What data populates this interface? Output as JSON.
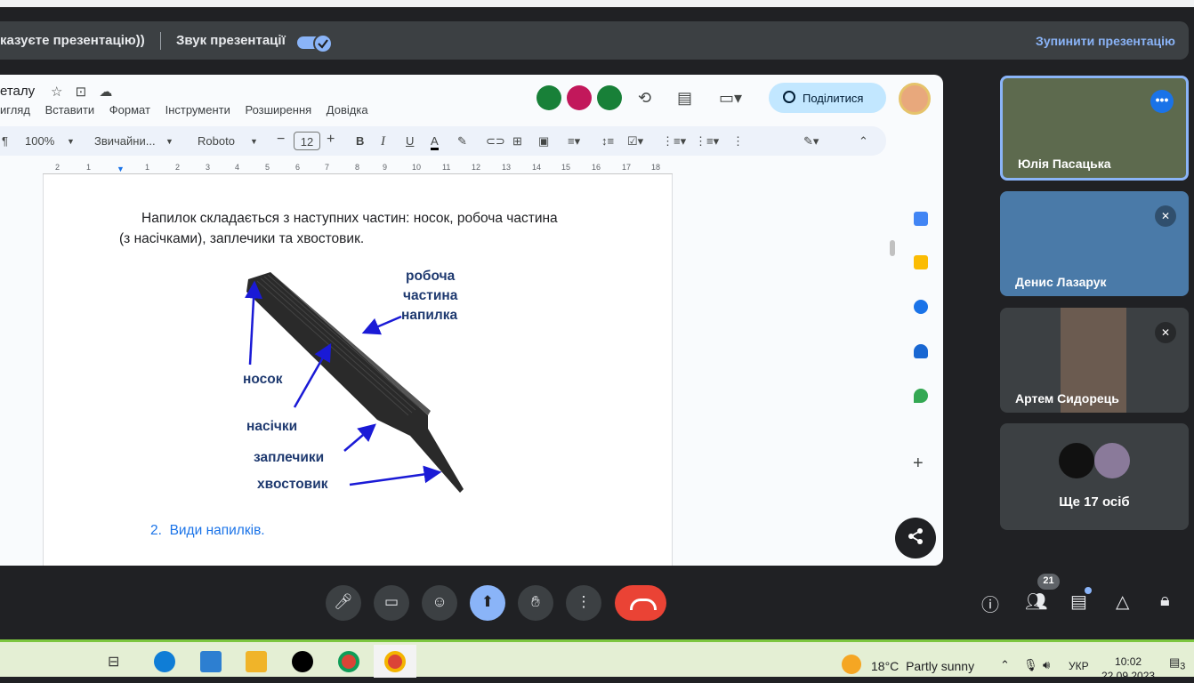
{
  "presentation_bar": {
    "message": "казуєте презентацію))",
    "sound_label": "Звук презентації",
    "sound_enabled": true,
    "stop_label": "Зупинити презентацію"
  },
  "doc": {
    "title": "еталу",
    "menu": [
      "игляд",
      "Вставити",
      "Формат",
      "Інструменти",
      "Розширення",
      "Довідка"
    ],
    "share_label": "Поділитися",
    "toolbar": {
      "zoom": "100%",
      "style": "Звичайни...",
      "font": "Roboto",
      "font_size": "12",
      "bold": "B",
      "italic": "I",
      "underline": "U",
      "text_color": "A"
    },
    "ruler_ticks": [
      "2",
      "1",
      "1",
      "2",
      "3",
      "4",
      "5",
      "6",
      "7",
      "8",
      "9",
      "10",
      "11",
      "12",
      "13",
      "14",
      "15",
      "16",
      "17",
      "18"
    ],
    "paragraph_line1": "Напилок складається з наступних частин: носок, робоча частина",
    "paragraph_line2": "(з насічками), заплечики та хвостовик.",
    "figure_labels": {
      "work_part_1": "робоча",
      "work_part_2": "частина",
      "work_part_3": "напилка",
      "nose": "носок",
      "notches": "насічки",
      "shoulders": "заплечики",
      "tail": "хвостовик"
    },
    "heading_number": "2.",
    "heading_text": "Види напилків."
  },
  "participants": [
    {
      "name": "Юлія Пасацька",
      "muted": false,
      "active": true
    },
    {
      "name": "Денис Лазарук",
      "muted": true
    },
    {
      "name": "Артем Сидорець",
      "muted": true
    }
  ],
  "more_participants": "Ще 17 осіб",
  "controls": {
    "people_count": "21"
  },
  "taskbar": {
    "weather_temp": "18°C",
    "weather_text": "Partly sunny",
    "language": "УКР",
    "time": "10:02",
    "date": "22.09.2023",
    "notification_count": "3"
  },
  "colors": {
    "accent": "#8ab4f8",
    "end_call": "#ea4335",
    "meet_bg": "#202124"
  }
}
